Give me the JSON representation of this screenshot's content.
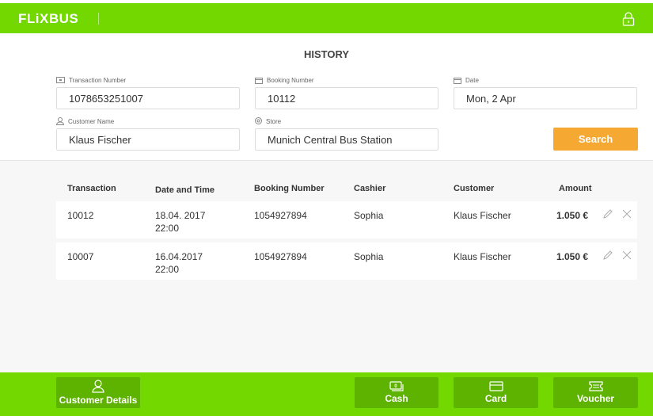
{
  "header": {
    "logo": "FLiXBUS"
  },
  "page_title": "HISTORY",
  "filters": {
    "transaction_number": {
      "label": "Transaction Number",
      "value": "1078653251007"
    },
    "booking_number": {
      "label": "Booking Number",
      "value": "10112"
    },
    "date": {
      "label": "Date",
      "value": "Mon, 2 Apr"
    },
    "customer_name": {
      "label": "Customer Name",
      "value": "Klaus Fischer"
    },
    "store": {
      "label": "Store",
      "value": "Munich Central Bus Station"
    },
    "search_label": "Search"
  },
  "table": {
    "headers": [
      "Transaction",
      "Date and Time",
      "Booking Number",
      "Cashier",
      "Customer",
      "Amount"
    ],
    "rows": [
      {
        "transaction": "10012",
        "date": "18.04. 2017",
        "time": "22:00",
        "booking": "1054927894",
        "cashier": "Sophia",
        "customer": "Klaus Fischer",
        "amount": "1.050 €"
      },
      {
        "transaction": "10007",
        "date": "16.04.2017",
        "time": "22:00",
        "booking": "1054927894",
        "cashier": "Sophia",
        "customer": "Klaus Fischer",
        "amount": "1.050 €"
      }
    ]
  },
  "footer": {
    "customer_details": "Customer Details",
    "cash": "Cash",
    "card": "Card",
    "voucher": "Voucher"
  }
}
